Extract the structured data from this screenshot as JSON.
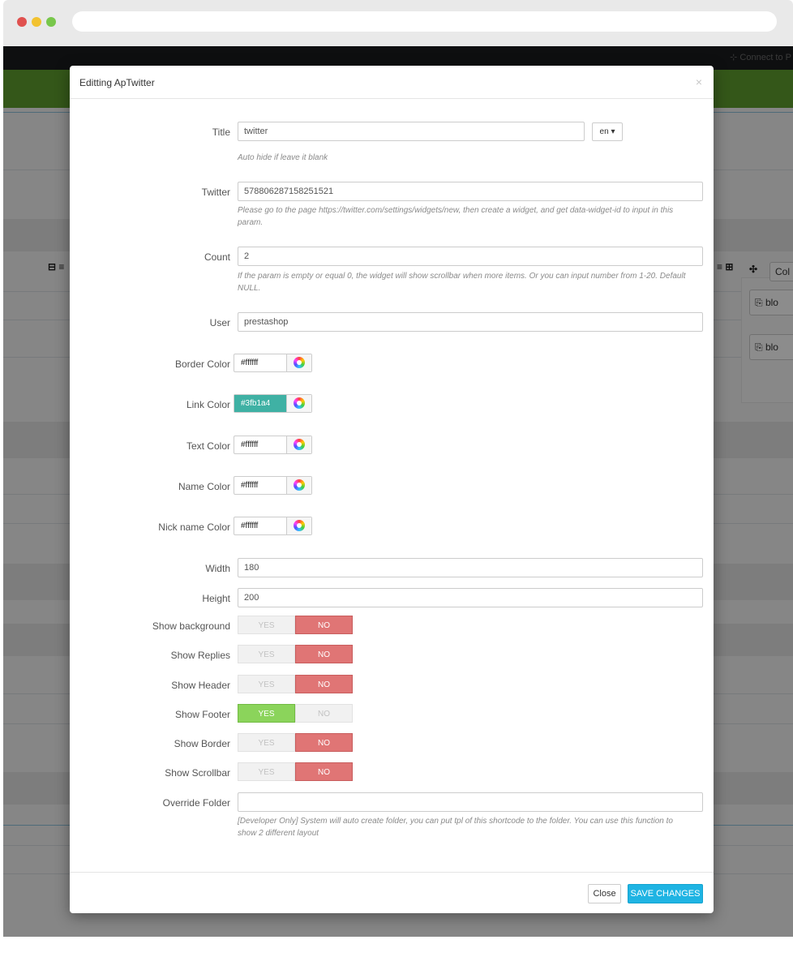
{
  "background": {
    "topnav_link": "⊹ Connect to P",
    "button_col": "Col",
    "button_bloc_1": "blo",
    "button_bloc_2": "blo"
  },
  "modal": {
    "title": "Editting ApTwitter",
    "close_symbol": "×",
    "fields": {
      "title": {
        "label": "Title",
        "value": "twitter",
        "help": "Auto hide if leave it blank",
        "language": "en"
      },
      "twitter": {
        "label": "Twitter",
        "value": "578806287158251521",
        "help": "Please go to the page https://twitter.com/settings/widgets/new, then create a widget, and get data-widget-id to input in this param."
      },
      "count": {
        "label": "Count",
        "value": "2",
        "help": "If the param is empty or equal 0, the widget will show scrollbar when more items. Or you can input number from 1-20. Default NULL."
      },
      "user": {
        "label": "User",
        "value": "prestashop"
      },
      "border_color": {
        "label": "Border Color",
        "value": "#ffffff",
        "swatch": "#ffffff"
      },
      "link_color": {
        "label": "Link Color",
        "value": "#3fb1a4",
        "swatch": "#3fb1a4"
      },
      "text_color": {
        "label": "Text Color",
        "value": "#ffffff",
        "swatch": "#ffffff"
      },
      "name_color": {
        "label": "Name Color",
        "value": "#ffffff",
        "swatch": "#ffffff"
      },
      "nick_name_color": {
        "label": "Nick name Color",
        "value": "#ffffff",
        "swatch": "#ffffff"
      },
      "width": {
        "label": "Width",
        "value": "180"
      },
      "height": {
        "label": "Height",
        "value": "200"
      },
      "override_folder": {
        "label": "Override Folder",
        "value": "",
        "help": "[Developer Only] System will auto create folder, you can put tpl of this shortcode to the folder. You can use this function to show 2 different layout"
      }
    },
    "toggles": {
      "yes_label": "YES",
      "no_label": "NO",
      "show_background": {
        "label": "Show background",
        "selected": "NO"
      },
      "show_replies": {
        "label": "Show Replies",
        "selected": "NO"
      },
      "show_header": {
        "label": "Show Header",
        "selected": "NO"
      },
      "show_footer": {
        "label": "Show Footer",
        "selected": "YES"
      },
      "show_border": {
        "label": "Show Border",
        "selected": "NO"
      },
      "show_scrollbar": {
        "label": "Show Scrollbar",
        "selected": "NO"
      }
    },
    "footer": {
      "close_label": "Close",
      "save_label": "SAVE CHANGES"
    }
  },
  "colors": {
    "save_button": "#1fb4e3",
    "yes_active": "#8bd45b",
    "no_active": "#e07575",
    "greenbar": "#5f9e2e"
  }
}
